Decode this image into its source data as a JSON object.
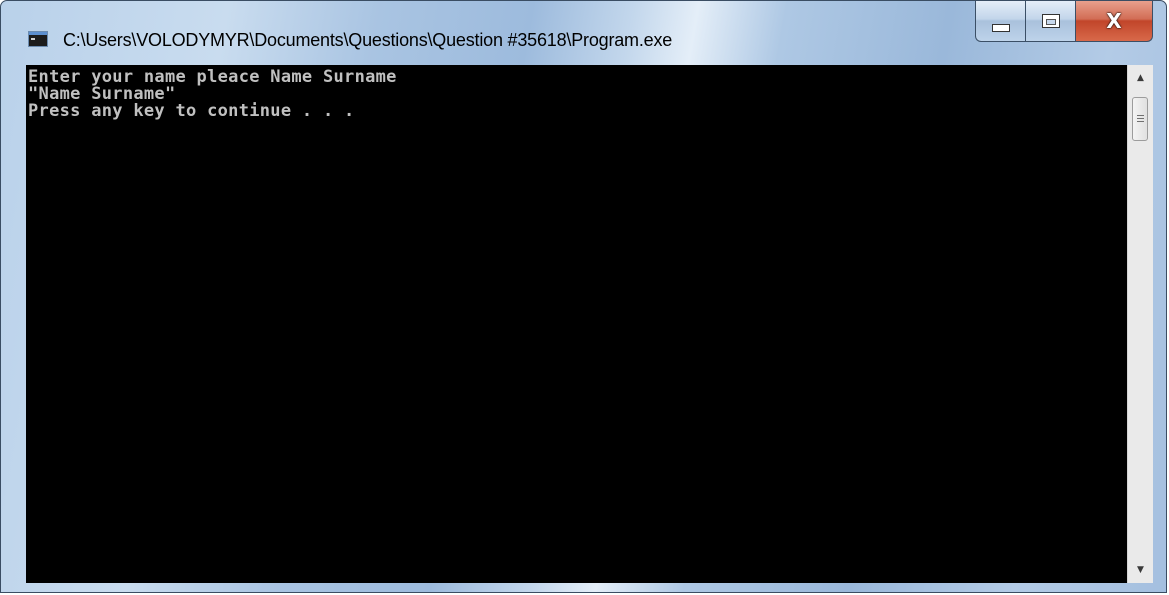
{
  "window": {
    "title": "C:\\Users\\VOLODYMYR\\Documents\\Questions\\Question #35618\\Program.exe",
    "icon": "console-app-icon",
    "buttons": {
      "minimize": "minimize-icon",
      "maximize": "maximize-icon",
      "close": "close-icon",
      "close_glyph": "X"
    }
  },
  "console": {
    "lines": [
      "Enter your name pleace Name Surname",
      "\"Name Surname\"",
      "Press any key to continue . . ."
    ]
  },
  "scrollbar": {
    "up_arrow": "▲",
    "down_arrow": "▼"
  },
  "colors": {
    "console_background": "#000000",
    "console_text": "#c0c0c0",
    "close_button": "#c1452a"
  }
}
